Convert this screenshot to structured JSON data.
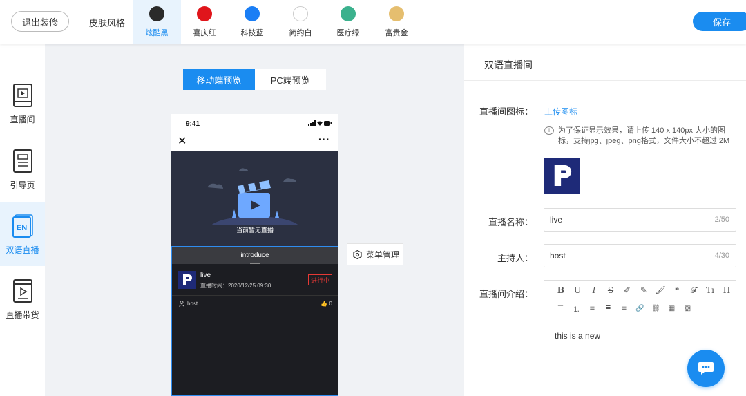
{
  "topbar": {
    "exit_label": "退出装修",
    "skin_label": "皮肤风格",
    "save_label": "保存",
    "skins": [
      {
        "name": "炫酷黑",
        "color": "#2a2a2a",
        "active": true
      },
      {
        "name": "喜庆红",
        "color": "#e0151b",
        "active": false
      },
      {
        "name": "科技蓝",
        "color": "#1a7ef5",
        "active": false
      },
      {
        "name": "简约白",
        "color": "#ffffff",
        "active": false
      },
      {
        "name": "医疗绿",
        "color": "#3bb18d",
        "active": false
      },
      {
        "name": "富贵金",
        "color": "#e5be6f",
        "active": false
      }
    ]
  },
  "sidebar": {
    "items": [
      {
        "label": "直播间",
        "icon": "video-play-icon",
        "active": false
      },
      {
        "label": "引导页",
        "icon": "document-icon",
        "active": false
      },
      {
        "label": "双语直播",
        "icon": "en-language-icon",
        "active": true
      },
      {
        "label": "直播带货",
        "icon": "shopping-play-icon",
        "active": false
      }
    ]
  },
  "preview": {
    "tabs": [
      {
        "label": "移动端预览",
        "active": true
      },
      {
        "label": "PC端预览",
        "active": false
      }
    ],
    "phone": {
      "time": "9:41",
      "no_live_text": "当前暂无直播",
      "intro_tab": "introduce",
      "live": {
        "title": "live",
        "time": "直播时间：2020/12/25 09:30",
        "status": "进行中"
      },
      "host": "host",
      "likes": "0"
    },
    "menu_manage_label": "菜单管理"
  },
  "panel": {
    "title": "双语直播间",
    "icon_field": {
      "label": "直播间图标：",
      "upload_label": "上传图标",
      "hint": "为了保证显示效果，请上传 140 x 140px 大小的图标，支持jpg、jpeg、png格式，文件大小不超过 2M"
    },
    "name_field": {
      "label": "直播名称：",
      "value": "live",
      "count": "2/50"
    },
    "host_field": {
      "label": "主持人：",
      "value": "host",
      "count": "4/30"
    },
    "intro_field": {
      "label": "直播间介绍：",
      "value": "this is a new",
      "toolbar_row1": [
        "B",
        "U",
        "I",
        "S",
        "✐",
        "✎",
        "🖌",
        "❝",
        "𝓕",
        "Tı",
        "H"
      ],
      "toolbar_row2": [
        "☰",
        "⒈",
        "≡",
        "≣",
        "≡",
        "🔗",
        "⛓",
        "▦",
        "▨"
      ]
    }
  },
  "colors": {
    "accent": "#1a8cf0",
    "live_bg": "#2b3041",
    "status_red": "#e53935",
    "brand_logo": "#1e2a78"
  }
}
